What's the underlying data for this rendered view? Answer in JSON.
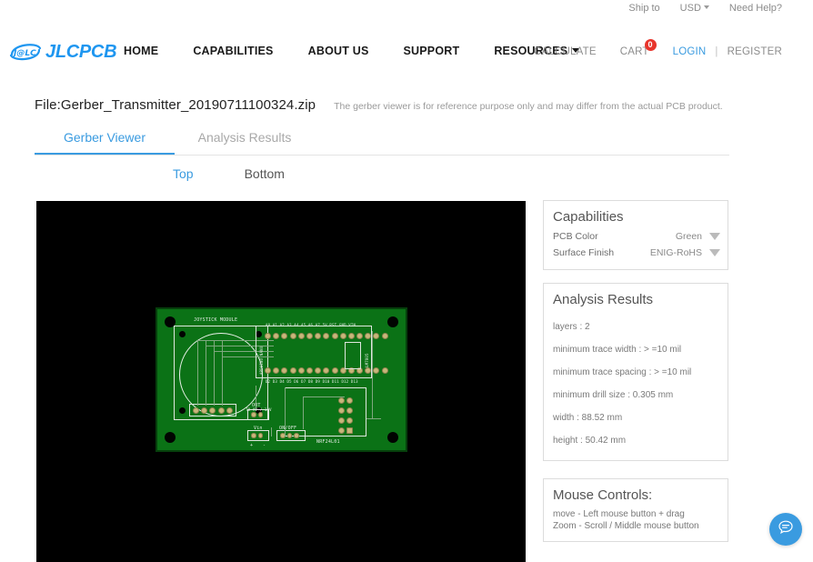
{
  "utility_bar": {
    "ship_to": "Ship to",
    "currency": "USD",
    "currency_icon": "chevron-down-icon",
    "need_help": "Need Help?"
  },
  "brand": {
    "logo_mark_text": "J@LC",
    "logo_text": "JLCPCB",
    "logo_color": "#1e96f0"
  },
  "nav": {
    "items": [
      {
        "label": "HOME",
        "has_caret": false
      },
      {
        "label": "CAPABILITIES",
        "has_caret": false
      },
      {
        "label": "ABOUT US",
        "has_caret": false
      },
      {
        "label": "SUPPORT",
        "has_caret": false
      },
      {
        "label": "RESOURCES",
        "has_caret": true
      }
    ],
    "calculate": "CALCULATE",
    "cart": "CART",
    "cart_count": "0",
    "cart_badge_color": "#e8352c",
    "login": "LOGIN",
    "separator": "|",
    "register": "REGISTER",
    "link_color": "#3a9be0"
  },
  "file": {
    "name": "File:Gerber_Transmitter_20190711100324.zip",
    "note": "The gerber viewer is for reference purpose only and may differ from the actual PCB product."
  },
  "main_tabs": [
    {
      "label": "Gerber Viewer",
      "active": true
    },
    {
      "label": "Analysis Results",
      "active": false
    }
  ],
  "side_tabs": [
    {
      "label": "Top",
      "active": true
    },
    {
      "label": "Bottom",
      "active": false
    }
  ],
  "viewer": {
    "background_color": "#000000",
    "board_color": "#0b7216",
    "silkscreen_labels": [
      "JOYSTICK MODULE",
      "ARDUINO NANO",
      "NRF24L01",
      "OUT",
      "Vin",
      "ON/OFF",
      "+",
      "-"
    ]
  },
  "capabilities": {
    "title": "Capabilities",
    "rows": [
      {
        "label": "PCB Color",
        "value": "Green",
        "icon": "dropdown-arrow-icon"
      },
      {
        "label": "Surface Finish",
        "value": "ENIG-RoHS",
        "icon": "dropdown-arrow-icon"
      }
    ]
  },
  "analysis": {
    "title": "Analysis Results",
    "items": [
      "layers : 2",
      "minimum trace width :  > =10 mil",
      "minimum trace spacing :  > =10 mil",
      "minimum drill size : 0.305 mm",
      "width : 88.52 mm",
      "height : 50.42 mm"
    ]
  },
  "mouse_controls": {
    "title": "Mouse Controls:",
    "lines": [
      "move - Left mouse button + drag",
      "Zoom - Scroll / Middle mouse button"
    ]
  },
  "chat": {
    "icon": "chat-bubble-icon",
    "color": "#3a9be0"
  }
}
